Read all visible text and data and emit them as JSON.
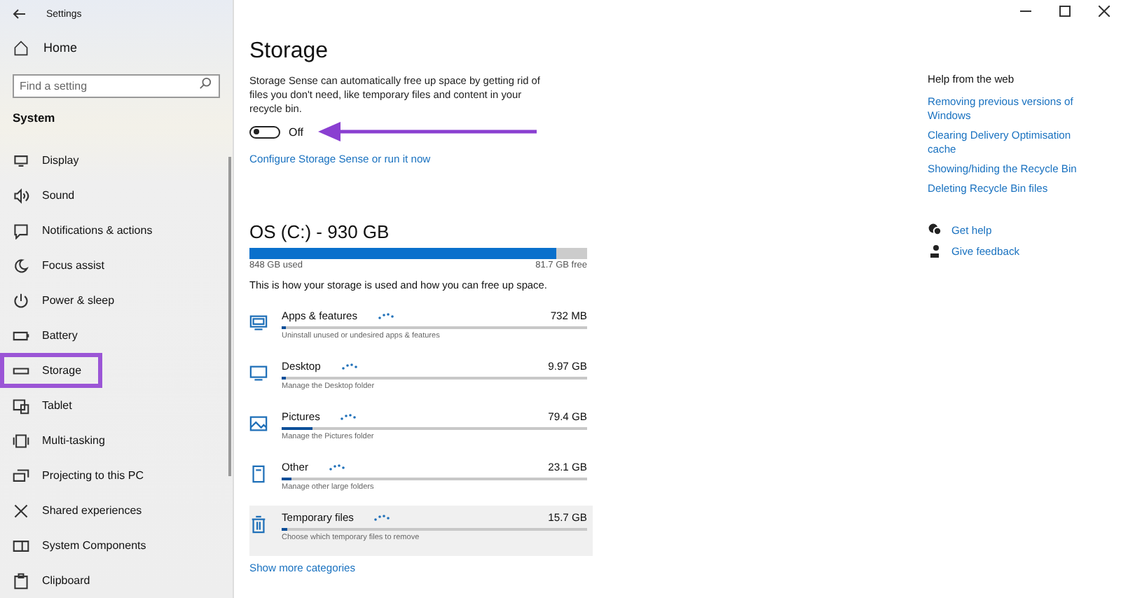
{
  "window": {
    "title": "Settings"
  },
  "sidebar": {
    "home": "Home",
    "search": {
      "placeholder": "Find a setting"
    },
    "section": "System",
    "items": [
      {
        "label": "Display",
        "selected": false
      },
      {
        "label": "Sound",
        "selected": false
      },
      {
        "label": "Notifications & actions",
        "selected": false
      },
      {
        "label": "Focus assist",
        "selected": false
      },
      {
        "label": "Power & sleep",
        "selected": false
      },
      {
        "label": "Battery",
        "selected": false
      },
      {
        "label": "Storage",
        "selected": true
      },
      {
        "label": "Tablet",
        "selected": false
      },
      {
        "label": "Multi-tasking",
        "selected": false
      },
      {
        "label": "Projecting to this PC",
        "selected": false
      },
      {
        "label": "Shared experiences",
        "selected": false
      },
      {
        "label": "System Components",
        "selected": false
      },
      {
        "label": "Clipboard",
        "selected": false
      }
    ]
  },
  "main": {
    "title": "Storage",
    "description": "Storage Sense can automatically free up space by getting rid of files you don't need, like temporary files and content in your recycle bin.",
    "toggle": {
      "on": false,
      "label": "Off"
    },
    "link": "Configure Storage Sense or run it now",
    "drive": {
      "title": "OS (C:) - 930 GB",
      "level": 0.91,
      "used": "848 GB used",
      "free": "81.7 GB free"
    },
    "usage_note": "This is how your storage is used and how you can free up space.",
    "categories": [
      {
        "name": "Apps & features",
        "size": "732 MB",
        "hint": "Uninstall unused or undesired apps & features",
        "level": 0.01,
        "selected": false
      },
      {
        "name": "Desktop",
        "size": "9.97 GB",
        "hint": "Manage the Desktop folder",
        "level": 0.01,
        "selected": false
      },
      {
        "name": "Pictures",
        "size": "79.4 GB",
        "hint": "Manage the Pictures folder",
        "level": 0.1,
        "selected": false
      },
      {
        "name": "Other",
        "size": "23.1 GB",
        "hint": "Manage other large folders",
        "level": 0.03,
        "selected": false
      },
      {
        "name": "Temporary files",
        "size": "15.7 GB",
        "hint": "Choose which temporary files to remove",
        "level": 0.02,
        "selected": true
      }
    ],
    "more": "Show more categories"
  },
  "help": {
    "title": "Help from the web",
    "links": [
      "Removing previous versions of Windows",
      "Clearing Delivery Optimisation cache",
      "Showing/hiding the Recycle Bin",
      "Deleting Recycle Bin files"
    ],
    "actions": [
      {
        "kind": "help",
        "label": "Get help"
      },
      {
        "kind": "feedback",
        "label": "Give feedback"
      }
    ]
  }
}
